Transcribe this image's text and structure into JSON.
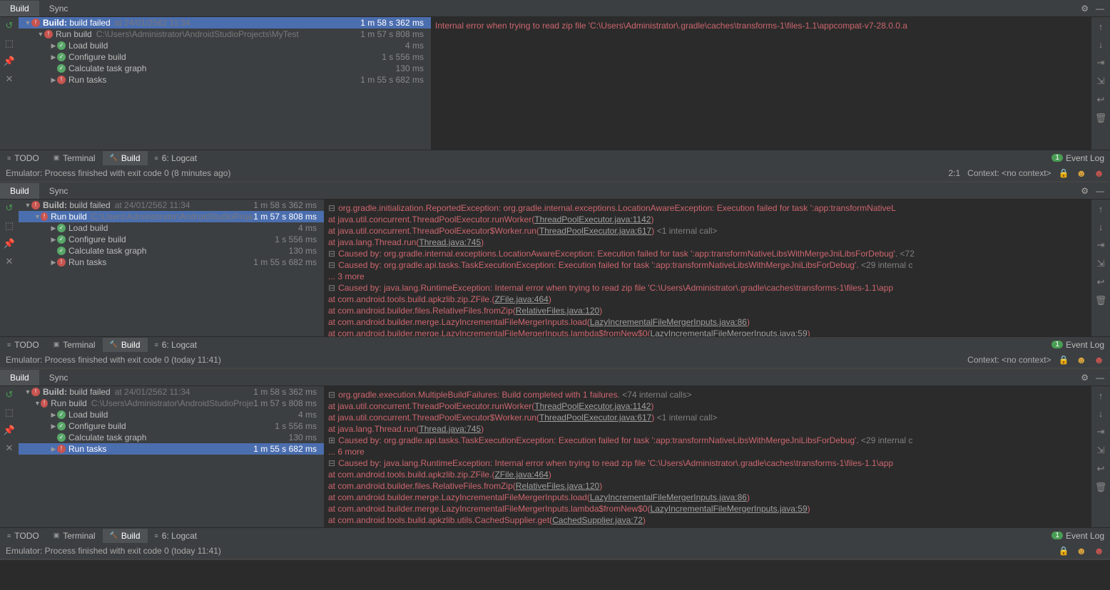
{
  "panels": [
    {
      "topTabs": [
        "Build",
        "Sync"
      ],
      "activeTop": 0,
      "treeWidth": 578,
      "tree": [
        {
          "indent": 0,
          "arrow": "▼",
          "icon": "err",
          "label": "Build:",
          "bold": "build failed",
          "meta": "at 24/01/2562 11:34",
          "time": "1 m 58 s 362 ms",
          "sel": true
        },
        {
          "indent": 1,
          "arrow": "▼",
          "icon": "err",
          "label": "Run build",
          "meta": "C:\\Users\\Administrator\\AndroidStudioProjects\\MyTest",
          "time": "1 m 57 s 808 ms"
        },
        {
          "indent": 2,
          "arrow": "▶",
          "icon": "ok",
          "label": "Load build",
          "time": "4 ms"
        },
        {
          "indent": 2,
          "arrow": "▶",
          "icon": "ok",
          "label": "Configure build",
          "time": "1 s 556 ms"
        },
        {
          "indent": 2,
          "arrow": "",
          "icon": "ok",
          "label": "Calculate task graph",
          "time": "130 ms"
        },
        {
          "indent": 2,
          "arrow": "▶",
          "icon": "err",
          "label": "Run tasks",
          "time": "1 m 55 s 682 ms"
        }
      ],
      "console": [
        {
          "t": "red",
          "s": "Internal error when trying to read zip file 'C:\\Users\\Administrator\\.gradle\\caches\\transforms-1\\files-1.1\\appcompat-v7-28.0.0.a"
        }
      ],
      "contentHeight": 186,
      "bottomTabs": [
        {
          "ic": "≡",
          "l": "TODO"
        },
        {
          "ic": "▣",
          "l": "Terminal"
        },
        {
          "ic": "🔨",
          "l": "Build",
          "a": true
        },
        {
          "ic": "≡",
          "l": "6: Logcat"
        }
      ],
      "status": "Emulator: Process finished with exit code 0 (8 minutes ago)",
      "statusRight": [
        "2:1",
        "Context: <no context>"
      ]
    },
    {
      "topTabs": [
        "Build",
        "Sync"
      ],
      "activeTop": 0,
      "treeWidth": 428,
      "tree": [
        {
          "indent": 0,
          "arrow": "▼",
          "icon": "err",
          "label": "Build:",
          "bold": "build failed",
          "meta": "at 24/01/2562 11:34",
          "time": "1 m 58 s 362 ms"
        },
        {
          "indent": 1,
          "arrow": "▼",
          "icon": "err",
          "label": "Run build",
          "meta": "C:\\Users\\Administrator\\AndroidStudioProje",
          "time": "1 m 57 s 808 ms",
          "sel": true
        },
        {
          "indent": 2,
          "arrow": "▶",
          "icon": "ok",
          "label": "Load build",
          "time": "4 ms"
        },
        {
          "indent": 2,
          "arrow": "▶",
          "icon": "ok",
          "label": "Configure build",
          "time": "1 s 556 ms"
        },
        {
          "indent": 2,
          "arrow": "",
          "icon": "ok",
          "label": "Calculate task graph",
          "time": "130 ms"
        },
        {
          "indent": 2,
          "arrow": "▶",
          "icon": "err",
          "label": "Run tasks",
          "time": "1 m 55 s 682 ms"
        }
      ],
      "console": [
        {
          "t": "red",
          "f": "⊟",
          "s": "org.gradle.initialization.ReportedException: org.gradle.internal.exceptions.LocationAwareException: Execution failed for task ':app:transformNativeL"
        },
        {
          "t": "at",
          "s": "        at java.util.concurrent.ThreadPoolExecutor.runWorker(",
          "u": "ThreadPoolExecutor.java:1142",
          "e": ")"
        },
        {
          "t": "at",
          "s": "        at java.util.concurrent.ThreadPoolExecutor$Worker.run(",
          "u": "ThreadPoolExecutor.java:617",
          "e": ") ",
          "g": "<1 internal call>"
        },
        {
          "t": "at",
          "s": "        at java.lang.Thread.run(",
          "u": "Thread.java:745",
          "e": ")"
        },
        {
          "t": "red",
          "f": "⊟",
          "s": "Caused by: org.gradle.internal.exceptions.LocationAwareException: Execution failed for task ':app:transformNativeLibsWithMergeJniLibsForDebug'. ",
          "g": "<72"
        },
        {
          "t": "red",
          "f": "⊟",
          "s": "Caused by: org.gradle.api.tasks.TaskExecutionException: Execution failed for task ':app:transformNativeLibsWithMergeJniLibsForDebug'. ",
          "g": "<29 internal c"
        },
        {
          "t": "red",
          "s": "     ... 3 more"
        },
        {
          "t": "red",
          "f": "⊟",
          "s": "Caused by: java.lang.RuntimeException: Internal error when trying to read zip file 'C:\\Users\\Administrator\\.gradle\\caches\\transforms-1\\files-1.1\\app"
        },
        {
          "t": "at",
          "s": "        at com.android.tools.build.apkzlib.zip.ZFile.<init>(",
          "u": "ZFile.java:464",
          "e": ")"
        },
        {
          "t": "at",
          "s": "        at com.android.builder.files.RelativeFiles.fromZip(",
          "u": "RelativeFiles.java:120",
          "e": ")"
        },
        {
          "t": "at",
          "s": "        at com.android.builder.merge.LazyIncrementalFileMergerInputs.load(",
          "u": "LazyIncrementalFileMergerInputs.java:86",
          "e": ")"
        },
        {
          "t": "at",
          "s": "        at com.android.builder.merge.LazyIncrementalFileMergerInputs.lambda$fromNew$0(",
          "u": "LazyIncrementalFileMergerInputs.java:59",
          "e": ")"
        }
      ],
      "contentHeight": 192,
      "bottomTabs": [
        {
          "ic": "≡",
          "l": "TODO"
        },
        {
          "ic": "▣",
          "l": "Terminal"
        },
        {
          "ic": "🔨",
          "l": "Build",
          "a": true
        },
        {
          "ic": "≡",
          "l": "6: Logcat"
        }
      ],
      "status": "Emulator: Process finished with exit code 0 (today 11:41)",
      "statusRight": [
        "Context: <no context>"
      ]
    },
    {
      "topTabs": [
        "Build",
        "Sync"
      ],
      "activeTop": 0,
      "treeWidth": 428,
      "tree": [
        {
          "indent": 0,
          "arrow": "▼",
          "icon": "err",
          "label": "Build:",
          "bold": "build failed",
          "meta": "at 24/01/2562 11:34",
          "time": "1 m 58 s 362 ms"
        },
        {
          "indent": 1,
          "arrow": "▼",
          "icon": "err",
          "label": "Run build",
          "meta": "C:\\Users\\Administrator\\AndroidStudioProje",
          "time": "1 m 57 s 808 ms"
        },
        {
          "indent": 2,
          "arrow": "▶",
          "icon": "ok",
          "label": "Load build",
          "time": "4 ms"
        },
        {
          "indent": 2,
          "arrow": "▶",
          "icon": "ok",
          "label": "Configure build",
          "time": "1 s 556 ms"
        },
        {
          "indent": 2,
          "arrow": "",
          "icon": "ok",
          "label": "Calculate task graph",
          "time": "130 ms"
        },
        {
          "indent": 2,
          "arrow": "▶",
          "icon": "err",
          "label": "Run tasks",
          "time": "1 m 55 s 682 ms",
          "sel": true
        }
      ],
      "console": [
        {
          "t": "red",
          "f": "⊟",
          "s": "org.gradle.execution.MultipleBuildFailures: Build completed with 1 failures. ",
          "g": "<74 internal calls>"
        },
        {
          "t": "at",
          "s": "        at java.util.concurrent.ThreadPoolExecutor.runWorker(",
          "u": "ThreadPoolExecutor.java:1142",
          "e": ")"
        },
        {
          "t": "at",
          "s": "        at java.util.concurrent.ThreadPoolExecutor$Worker.run(",
          "u": "ThreadPoolExecutor.java:617",
          "e": ") ",
          "g": "<1 internal call>"
        },
        {
          "t": "at",
          "s": "        at java.lang.Thread.run(",
          "u": "Thread.java:745",
          "e": ")"
        },
        {
          "t": "red",
          "f": "⊞",
          "s": "Caused by: org.gradle.api.tasks.TaskExecutionException: Execution failed for task ':app:transformNativeLibsWithMergeJniLibsForDebug'. ",
          "g": "<29 internal c"
        },
        {
          "t": "red",
          "s": "     ... 6 more"
        },
        {
          "t": "red",
          "f": "⊟",
          "s": "Caused by: java.lang.RuntimeException: Internal error when trying to read zip file 'C:\\Users\\Administrator\\.gradle\\caches\\transforms-1\\files-1.1\\app"
        },
        {
          "t": "at",
          "s": "        at com.android.tools.build.apkzlib.zip.ZFile.<init>(",
          "u": "ZFile.java:464",
          "e": ")"
        },
        {
          "t": "at",
          "s": "        at com.android.builder.files.RelativeFiles.fromZip(",
          "u": "RelativeFiles.java:120",
          "e": ")"
        },
        {
          "t": "at",
          "s": "        at com.android.builder.merge.LazyIncrementalFileMergerInputs.load(",
          "u": "LazyIncrementalFileMergerInputs.java:86",
          "e": ")"
        },
        {
          "t": "at",
          "s": "        at com.android.builder.merge.LazyIncrementalFileMergerInputs.lambda$fromNew$0(",
          "u": "LazyIncrementalFileMergerInputs.java:59",
          "e": ")"
        },
        {
          "t": "at",
          "s": "        at com.android.tools.build.apkzlib.utils.CachedSupplier.get(",
          "u": "CachedSupplier.java:72",
          "e": ")"
        }
      ],
      "contentHeight": 198,
      "bottomTabs": [
        {
          "ic": "≡",
          "l": "TODO"
        },
        {
          "ic": "▣",
          "l": "Terminal"
        },
        {
          "ic": "🔨",
          "l": "Build",
          "a": true
        },
        {
          "ic": "≡",
          "l": "6: Logcat"
        }
      ],
      "status": "Emulator: Process finished with exit code 0 (today 11:41)",
      "statusRight": []
    }
  ],
  "eventLog": "Event Log",
  "sideIcons": [
    "↺",
    "⬚",
    "📌",
    "✕"
  ],
  "rightIcons": [
    "↑",
    "↓",
    "⇥",
    "⇲",
    "↩",
    "🗑"
  ],
  "lockIcon": "🔒"
}
